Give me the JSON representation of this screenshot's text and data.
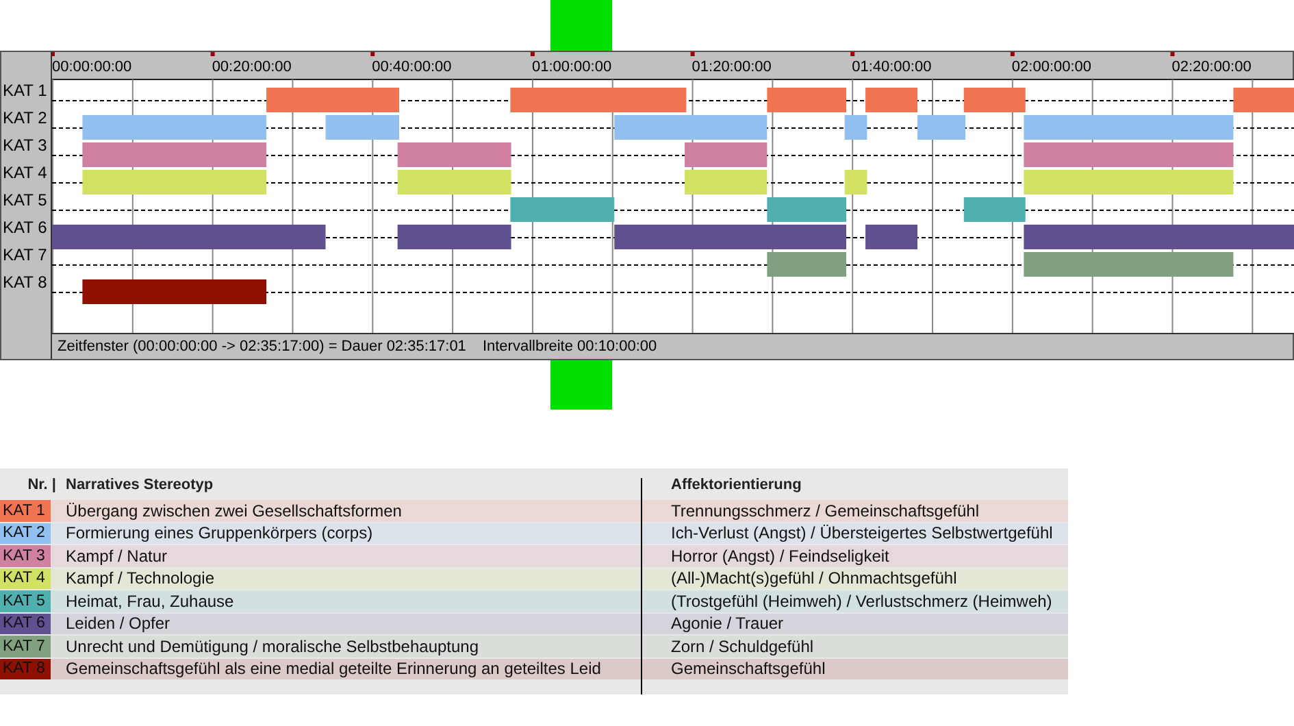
{
  "timeline": {
    "ticks": [
      "00:00:00:00",
      "00:20:00:00",
      "00:40:00:00",
      "01:00:00:00",
      "01:20:00:00",
      "01:40:00:00",
      "02:00:00:00",
      "02:20:00:00"
    ],
    "rows": [
      {
        "label": "KAT 1",
        "color": "#f07352"
      },
      {
        "label": "KAT 2",
        "color": "#90bff0"
      },
      {
        "label": "KAT 3",
        "color": "#d080a0"
      },
      {
        "label": "KAT 4",
        "color": "#d2e064"
      },
      {
        "label": "KAT 5",
        "color": "#50b0b0"
      },
      {
        "label": "KAT 6",
        "color": "#605090"
      },
      {
        "label": "KAT 7",
        "color": "#80a080"
      },
      {
        "label": "KAT 8",
        "color": "#901000"
      }
    ],
    "status": {
      "window": "Zeitfenster (00:00:00:00 -> 02:35:17:00) = Dauer 02:35:17:01",
      "interval": "Intervallbreite 00:10:00:00"
    }
  },
  "legend": {
    "headers": {
      "nr": "Nr. |",
      "stereotype": "Narratives Stereotyp",
      "affect": "Affektorientierung"
    },
    "rows": [
      {
        "nr": "KAT 1",
        "color": "#f07352",
        "stereotype": "Übergang zwischen zwei Gesellschaftsformen",
        "affect": "Trennungsschmerz / Gemeinschaftsgefühl"
      },
      {
        "nr": "KAT 2",
        "color": "#90bff0",
        "stereotype": "Formierung eines Gruppenkörpers (corps)",
        "affect": "Ich-Verlust (Angst) / Übersteigertes Selbstwertgefühl"
      },
      {
        "nr": "KAT 3",
        "color": "#d080a0",
        "stereotype": "Kampf / Natur",
        "affect": "Horror (Angst) / Feindseligkeit"
      },
      {
        "nr": "KAT 4",
        "color": "#d2e064",
        "stereotype": "Kampf / Technologie",
        "affect": "(All-)Macht(s)gefühl / Ohnmachtsgefühl"
      },
      {
        "nr": "KAT 5",
        "color": "#50b0b0",
        "stereotype": "Heimat, Frau, Zuhause",
        "affect": "(Trostgefühl (Heimweh) / Verlustschmerz (Heimweh)"
      },
      {
        "nr": "KAT 6",
        "color": "#605090",
        "stereotype": "Leiden / Opfer",
        "affect": "Agonie / Trauer"
      },
      {
        "nr": "KAT 7",
        "color": "#80a080",
        "stereotype": "Unrecht und Demütigung / moralische Selbstbehauptung",
        "affect": "Zorn / Schuldgefühl"
      },
      {
        "nr": "KAT 8",
        "color": "#901000",
        "stereotype": "Gemeinschaftsgefühl als eine medial geteilte Erinnerung an geteiltes Leid",
        "affect": "Gemeinschaftsgefühl"
      }
    ]
  }
}
